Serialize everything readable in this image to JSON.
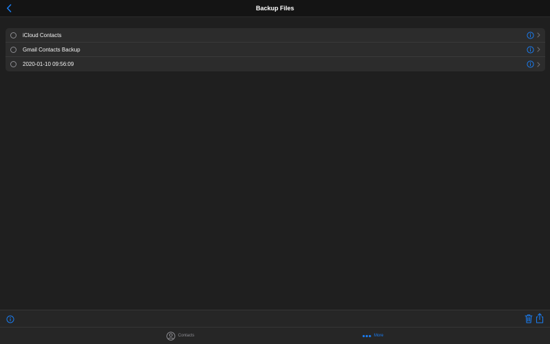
{
  "nav": {
    "title": "Backup Files",
    "back_icon": "chevron-left-icon"
  },
  "files": [
    {
      "label": "iCloud Contacts"
    },
    {
      "label": "Gmail Contacts Backup"
    },
    {
      "label": "2020-01-10 09:56:09"
    }
  ],
  "toolbar": {
    "info_icon": "info-icon",
    "trash_icon": "trash-icon",
    "share_icon": "share-icon"
  },
  "tabs": [
    {
      "label": "Contacts",
      "icon": "person-circle-icon",
      "selected": false
    },
    {
      "label": "More",
      "icon": "ellipsis-icon",
      "selected": true
    }
  ],
  "colors": {
    "accent": "#1a7cf0",
    "background": "#1f1f1f",
    "list_bg": "#2c2c2c",
    "bar_bg": "#262626"
  }
}
